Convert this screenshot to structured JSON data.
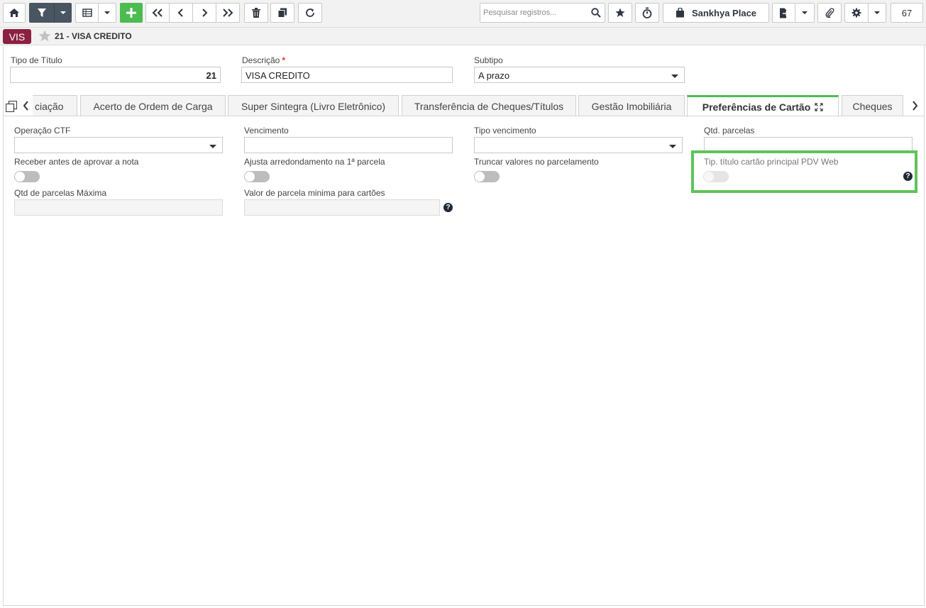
{
  "toolbar": {
    "search_placeholder": "Pesquisar registros...",
    "place_label": "Sankhya Place",
    "record_count": "67",
    "icons": [
      "home-icon",
      "filter-icon",
      "grid-icon",
      "add-icon",
      "first-icon",
      "previous-icon",
      "next-icon",
      "last-icon",
      "delete-icon",
      "copy-icon",
      "refresh-icon",
      "search-icon",
      "star-icon",
      "stopwatch-icon",
      "shopping-bag-icon",
      "export-icon",
      "attachment-icon",
      "gear-icon"
    ]
  },
  "header": {
    "badge": "VIS",
    "record_title": "21 - VISA CREDITO"
  },
  "form": {
    "tipo_titulo": {
      "label": "Tipo de Título",
      "value": "21"
    },
    "descricao": {
      "label": "Descrição",
      "required_mark": "*",
      "value": "VISA CREDITO"
    },
    "subtipo": {
      "label": "Subtipo",
      "value": "A prazo"
    }
  },
  "tabs": [
    {
      "label": "ciação"
    },
    {
      "label": "Acerto de Ordem de Carga"
    },
    {
      "label": "Super Sintegra (Livro Eletrônico)"
    },
    {
      "label": "Transferência de Cheques/Títulos"
    },
    {
      "label": "Gestão Imobiliária"
    },
    {
      "label": "Preferências de Cartão",
      "active": true
    },
    {
      "label": "Cheques"
    }
  ],
  "card_prefs": {
    "operacao_ctf": {
      "label": "Operação CTF",
      "value": ""
    },
    "vencimento": {
      "label": "Vencimento",
      "value": ""
    },
    "tipo_vencimento": {
      "label": "Tipo vencimento",
      "value": ""
    },
    "qtd_parcelas": {
      "label": "Qtd. parcelas",
      "value": ""
    },
    "receber_antes": {
      "label": "Receber antes de aprovar a nota",
      "on": false
    },
    "ajusta_arredondamento": {
      "label": "Ajusta arredondamento na 1ª parcela",
      "on": false
    },
    "truncar_valores": {
      "label": "Truncar valores no parcelamento",
      "on": false
    },
    "tip_titulo_pdv": {
      "label": "Tip. título cartão principal PDV Web",
      "on": false,
      "disabled": true
    },
    "qtd_parcelas_max": {
      "label": "Qtd de parcelas Máxima",
      "value": ""
    },
    "valor_parcela_min": {
      "label": "Valor de parcela minima para cartões",
      "value": ""
    }
  },
  "colors": {
    "accent_green": "#4cbb50",
    "badge": "#8b2140",
    "highlight": "#5ec45a"
  }
}
